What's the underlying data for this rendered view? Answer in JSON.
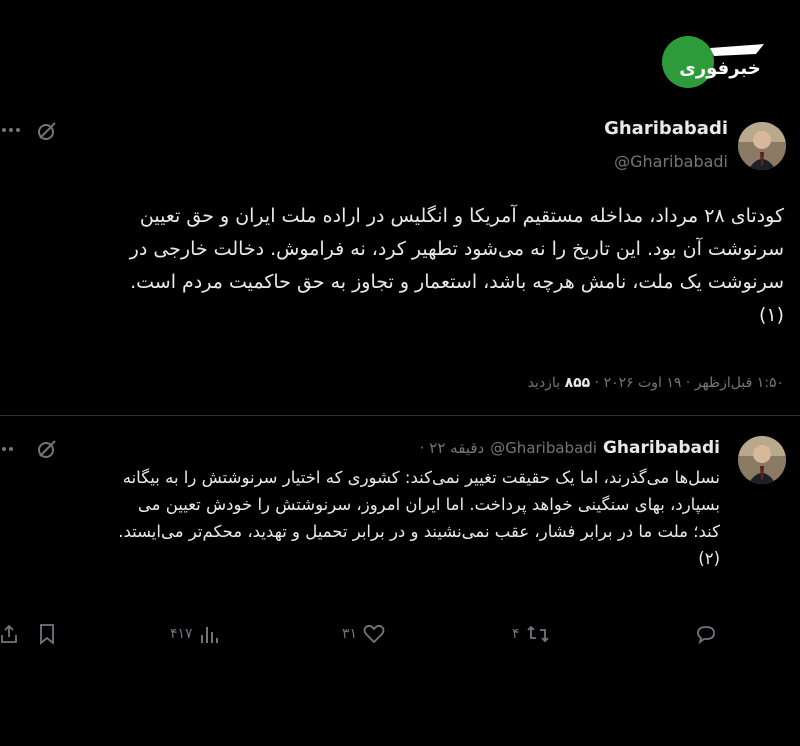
{
  "logo": {
    "text": "خبرفوری"
  },
  "tweet1": {
    "author_name": "Gharibabadi",
    "author_handle": "@Gharibabadi",
    "text_lines": [
      "کودتای ۲۸ مرداد، مداخله مستقیم آمریکا و انگلیس در اراده ملت ایران و حق تعیین",
      "سرنوشت آن بود. این تاریخ را نه می‌شود تطهیر کرد، نه فراموش. دخالت خارجی در",
      "سرنوشت یک ملت، نامش هرچه باشد، استعمار و تجاوز به حق حاکمیت مردم است.",
      "(۱)"
    ],
    "timestamp": "۱:۵۰ قبل‌ازظهر · ۱۹ اوت ۲۰۲۶ · ",
    "views_count": "۸۵۵",
    "views_label": " بازدید"
  },
  "tweet2": {
    "author_name": "Gharibabadi",
    "author_handle": "@Gharibabadi",
    "time_ago": "· ۲۲ دقیقه",
    "text_lines": [
      "نسل‌ها می‌گذرند، اما یک حقیقت تغییر نمی‌کند: کشوری که اختیار سرنوشتش را به بیگانه",
      "بسپارد، بهای سنگینی خواهد پرداخت. اما ایران امروز، سرنوشتش را خودش تعیین می",
      "کند؛ ملت ما در برابر فشار، عقب نمی‌نشیند و در برابر تحمیل و تهدید، محکم‌تر می‌ایستد.",
      "(۲)"
    ],
    "actions": {
      "views": "۴۱۷",
      "likes": "۳۱",
      "retweets": "۴"
    }
  },
  "colors": {
    "background": "#000000",
    "text": "#e7e9ea",
    "muted": "#71767b",
    "logo_green": "#2e9b3a"
  }
}
